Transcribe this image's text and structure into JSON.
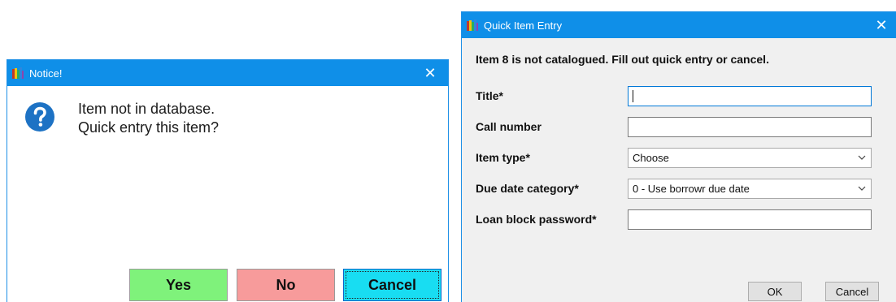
{
  "notice": {
    "title": "Notice!",
    "close_glyph": "✕",
    "icon": "question-icon",
    "message_line1": "Item not in database.",
    "message_line2": "Quick entry this item?",
    "buttons": {
      "yes": "Yes",
      "no": "No",
      "cancel": "Cancel"
    },
    "colors": {
      "titlebar": "#0f8fe8",
      "yes": "#7ff27b",
      "no": "#f79b9b",
      "cancel": "#18ddf2"
    }
  },
  "quick_entry": {
    "title": "Quick Item Entry",
    "close_glyph": "✕",
    "heading": "Item 8 is not catalogued. Fill out quick entry or cancel.",
    "fields": {
      "title_label": "Title*",
      "title_value": "",
      "call_number_label": "Call number",
      "call_number_value": "",
      "item_type_label": "Item type*",
      "item_type_value": "Choose",
      "due_date_label": "Due date category*",
      "due_date_value": "0 - Use borrowr due date",
      "loan_block_label": "Loan block password*",
      "loan_block_value": ""
    },
    "buttons": {
      "ok": "OK",
      "cancel": "Cancel"
    }
  }
}
